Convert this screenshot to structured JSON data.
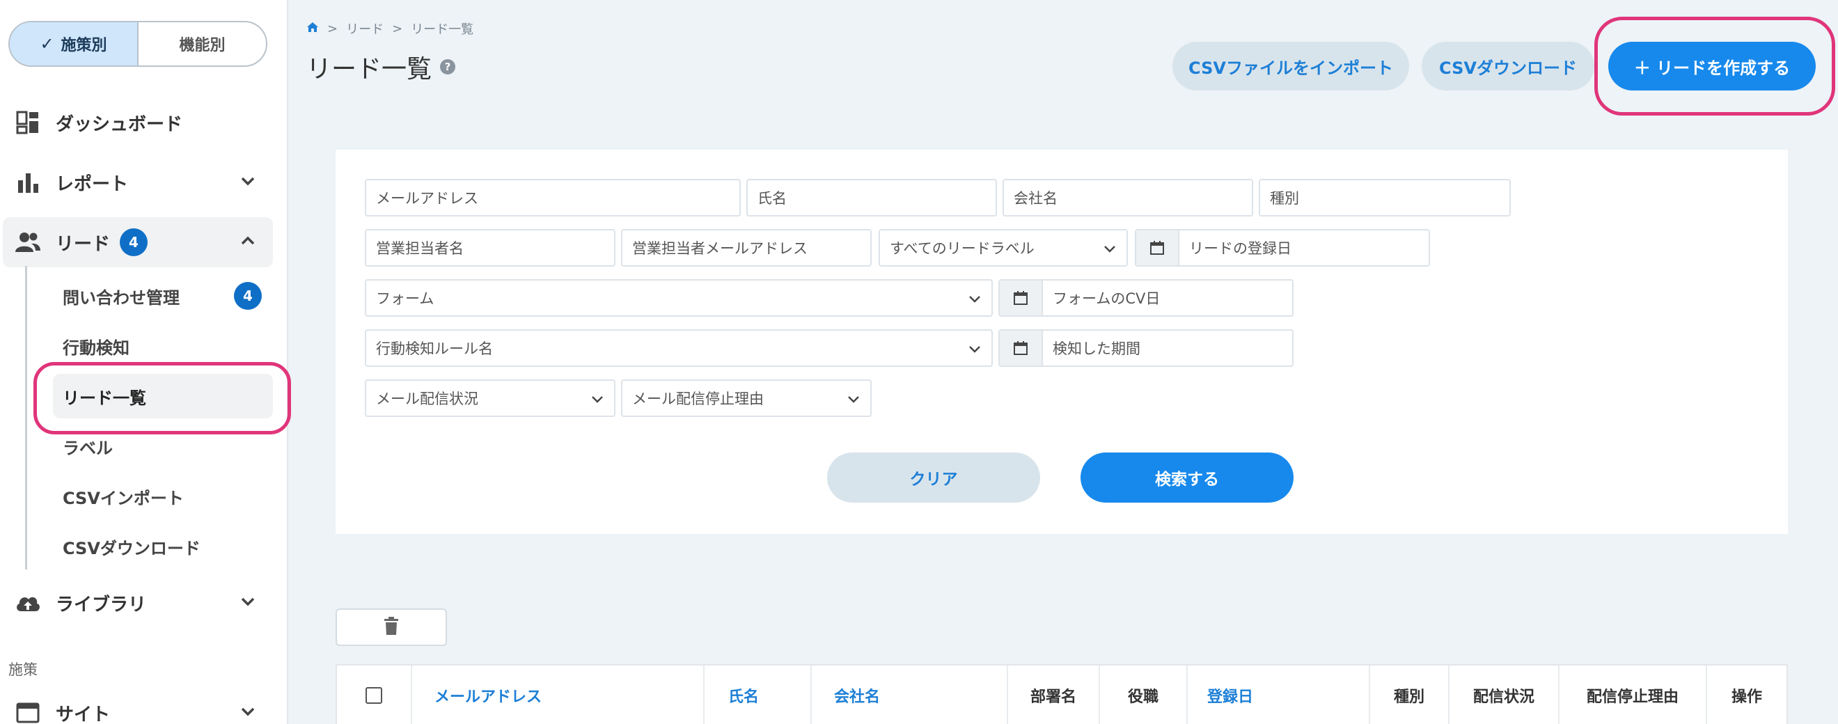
{
  "sidebar": {
    "toggle": {
      "active": "施策別",
      "inactive": "機能別"
    },
    "items": [
      {
        "label": "ダッシュボード"
      },
      {
        "label": "レポート"
      },
      {
        "label": "リード",
        "badge": "4"
      }
    ],
    "sub_items": [
      {
        "label": "問い合わせ管理",
        "badge": "4"
      },
      {
        "label": "行動検知"
      },
      {
        "label": "リード一覧"
      },
      {
        "label": "ラベル"
      },
      {
        "label": "CSVインポート"
      },
      {
        "label": "CSVダウンロード"
      }
    ],
    "library": "ライブラリ",
    "section_label": "施策",
    "site": "サイト"
  },
  "breadcrumb": {
    "sep": ">",
    "items": [
      "リード",
      "リード一覧"
    ]
  },
  "header": {
    "title": "リード一覧",
    "help": "?",
    "import_label": "CSVファイルをインポート",
    "download_label": "CSVダウンロード",
    "create_label": "＋ リードを作成する"
  },
  "filters": {
    "email": "メールアドレス",
    "name": "氏名",
    "company": "会社名",
    "type": "種別",
    "sales_name": "営業担当者名",
    "sales_email": "営業担当者メールアドレス",
    "label_select": "すべてのリードラベル",
    "registered_date": "リードの登録日",
    "form_select": "フォーム",
    "form_cv_date": "フォームのCV日",
    "rule_select": "行動検知ルール名",
    "detected_period": "検知した期間",
    "mail_status": "メール配信状況",
    "mail_stop_reason": "メール配信停止理由",
    "clear": "クリア",
    "search": "検索する"
  },
  "table": {
    "columns": [
      "メールアドレス",
      "氏名",
      "会社名",
      "部署名",
      "役職",
      "登録日",
      "種別",
      "配信状況",
      "配信停止理由",
      "操作"
    ]
  },
  "colors": {
    "accent": "#1789ec",
    "highlight": "#e0357a",
    "badge": "#0f6fc6"
  }
}
